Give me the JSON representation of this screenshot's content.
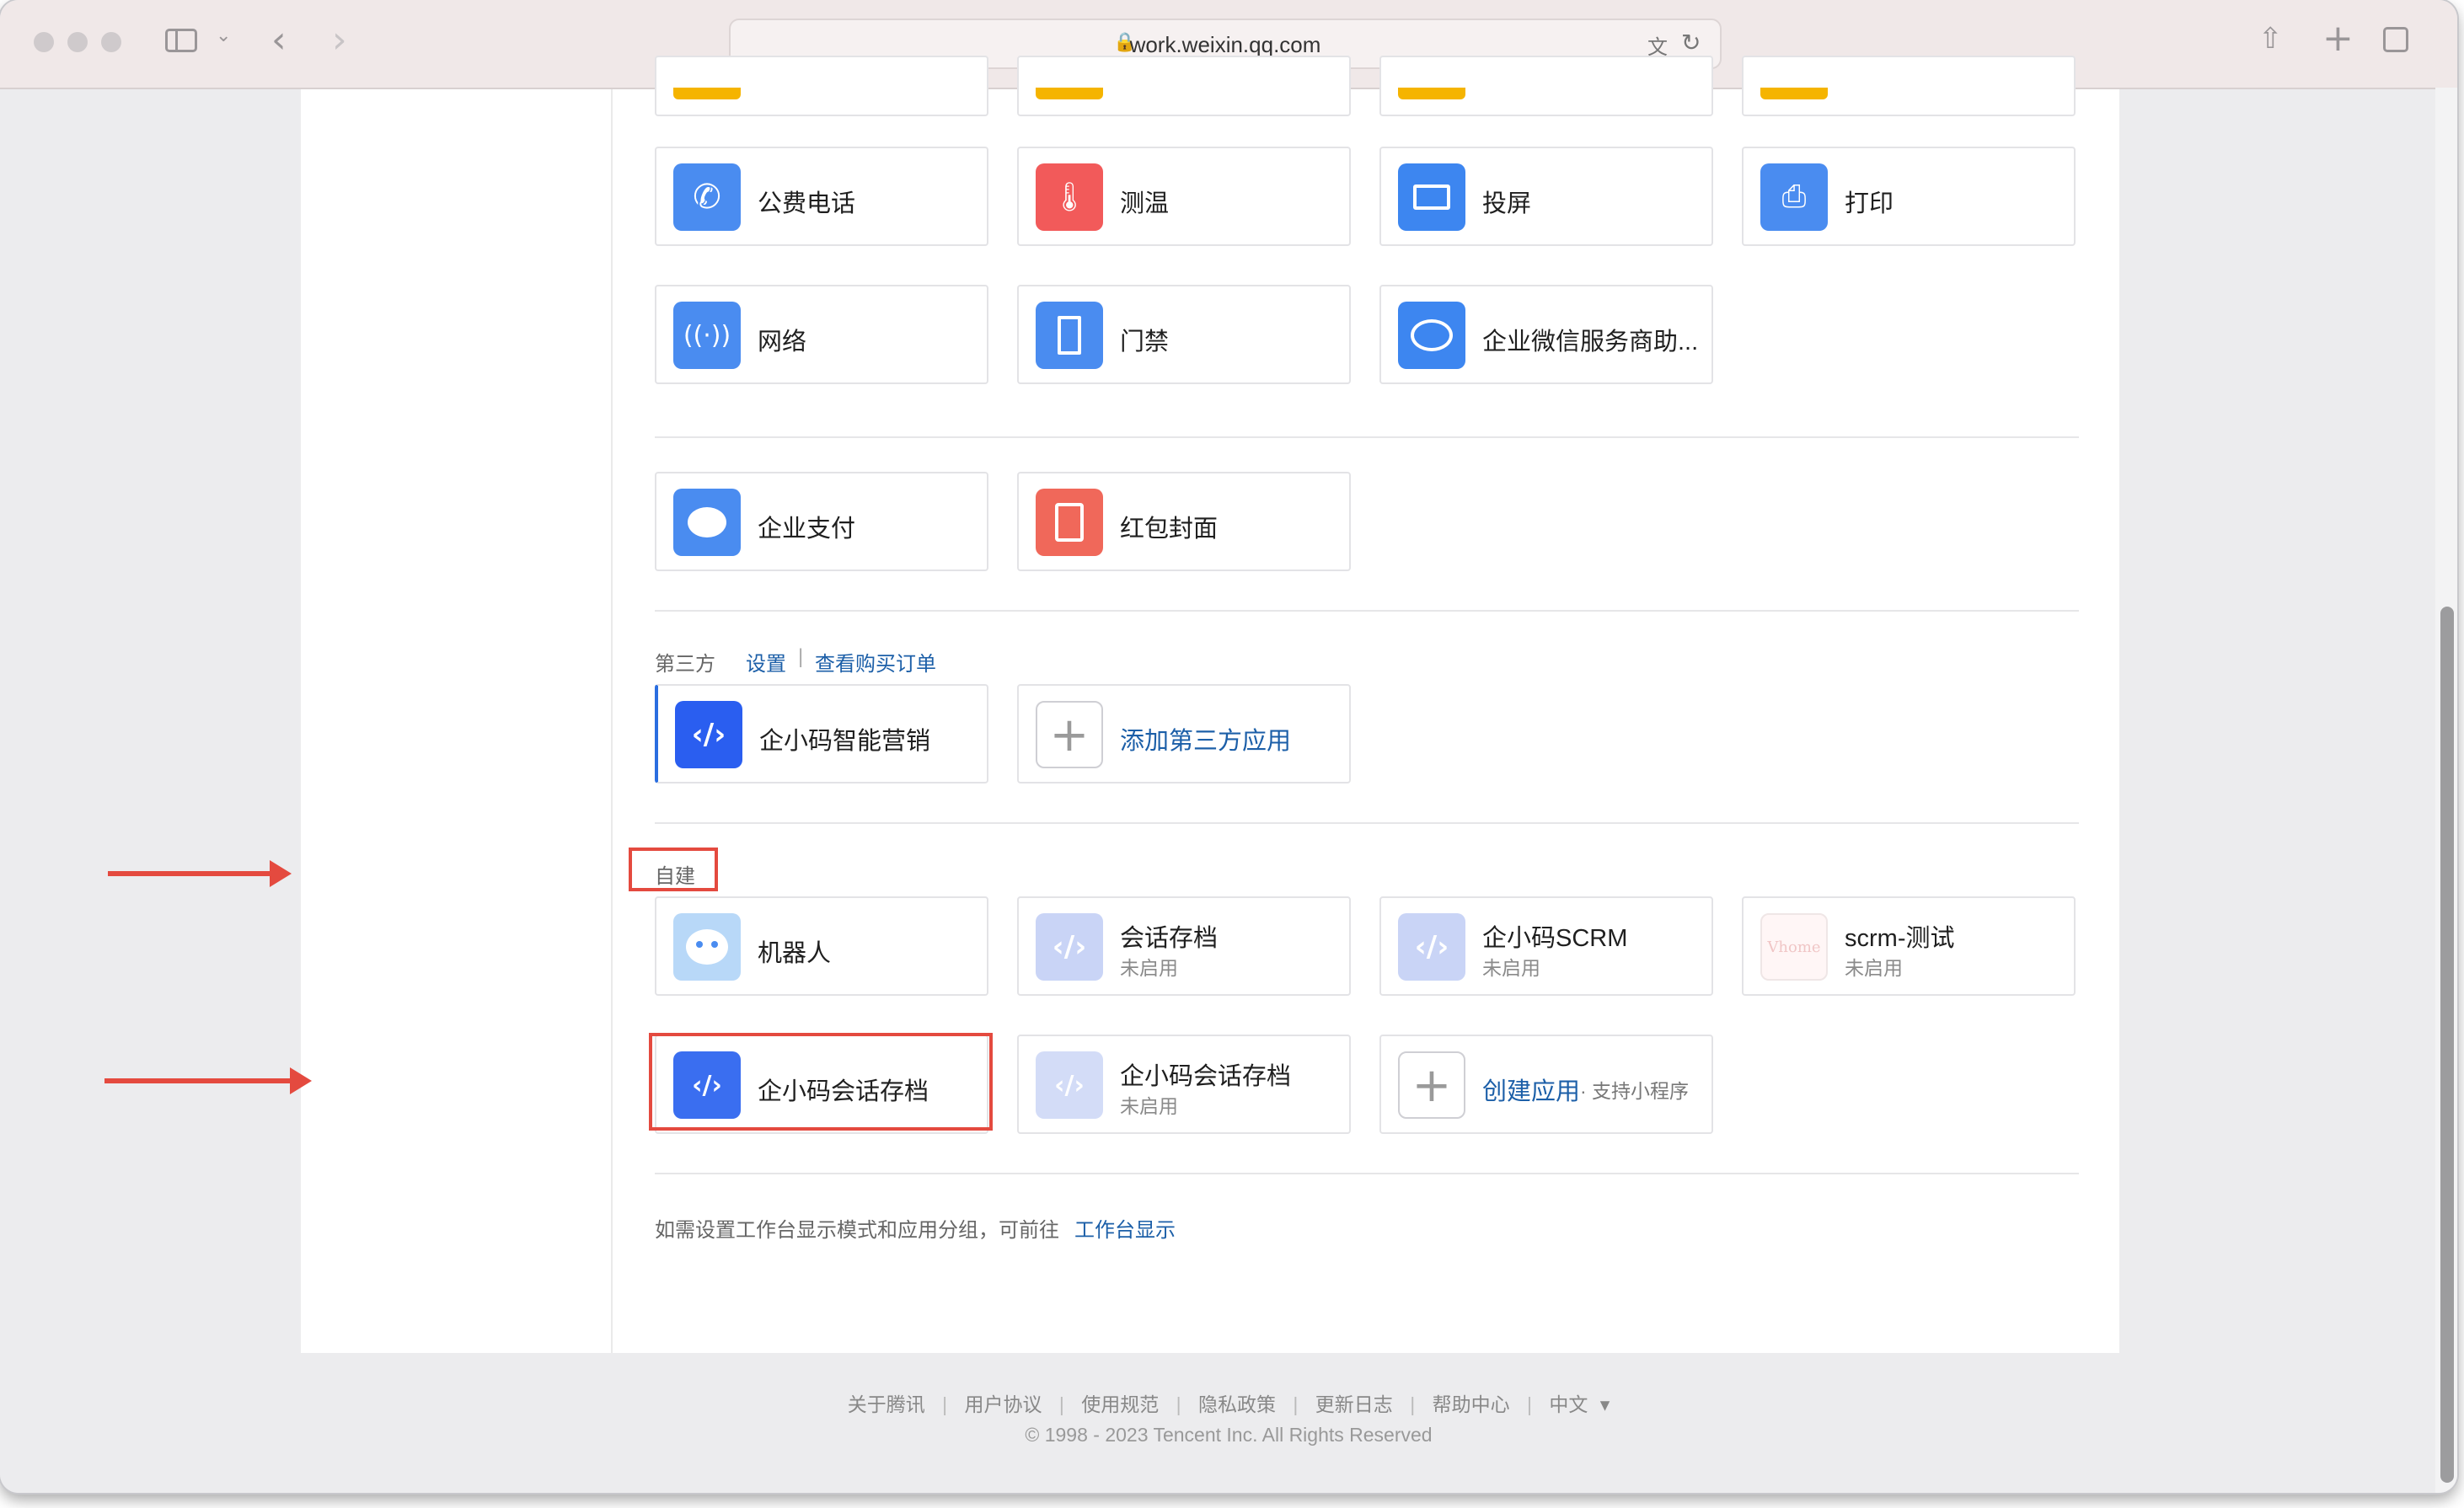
{
  "browser": {
    "url": "work.weixin.qq.com"
  },
  "apps_row1": [
    {
      "name": "公费电话",
      "icon": "phone-icon",
      "color": "#4a8cf0"
    },
    {
      "name": "测温",
      "icon": "thermometer-icon",
      "color": "#f25a5a"
    },
    {
      "name": "投屏",
      "icon": "screen-cast-icon",
      "color": "#3d86f0"
    },
    {
      "name": "打印",
      "icon": "printer-icon",
      "color": "#4a8cf0"
    }
  ],
  "apps_row2": [
    {
      "name": "网络",
      "icon": "router-icon",
      "color": "#4a8cf0"
    },
    {
      "name": "门禁",
      "icon": "door-icon",
      "color": "#4a8cf0"
    },
    {
      "name": "企业微信服务商助...",
      "icon": "chat-bubble-icon",
      "color": "#3d86f0"
    }
  ],
  "apps_pay": [
    {
      "name": "企业支付",
      "icon": "pay-icon",
      "color": "#4a8cf0"
    },
    {
      "name": "红包封面",
      "icon": "red-envelope-icon",
      "color": "#f0685a"
    }
  ],
  "third_party": {
    "label": "第三方",
    "settings": "设置",
    "separator": "|",
    "orders": "查看购买订单",
    "apps": [
      {
        "name": "企小码智能营销",
        "icon": "code-icon",
        "color": "#2a5ef0"
      }
    ],
    "add": "添加第三方应用"
  },
  "self_built": {
    "label": "自建",
    "apps": [
      {
        "name": "机器人",
        "sub": "",
        "icon": "robot-icon",
        "color": "#b8d8f8"
      },
      {
        "name": "会话存档",
        "sub": "未启用",
        "icon": "code-icon",
        "color": "#c9d4f6"
      },
      {
        "name": "企小码SCRM",
        "sub": "未启用",
        "icon": "code-icon",
        "color": "#c9d4f6"
      },
      {
        "name": "scrm-测试",
        "sub": "未启用",
        "icon": "vhome-logo-icon",
        "color": "#fff6f6",
        "logo_text": "Vhome"
      },
      {
        "name": "企小码会话存档",
        "sub": "",
        "icon": "code-icon",
        "color": "#3a6ef0"
      },
      {
        "name": "企小码会话存档",
        "sub": "未启用",
        "icon": "code-icon",
        "color": "#d3dcf7"
      }
    ],
    "create": "创建应用",
    "create_note": "· 支持小程序"
  },
  "hint": {
    "text": "如需设置工作台显示模式和应用分组，可前往",
    "link": "工作台显示"
  },
  "footer": {
    "links": [
      "关于腾讯",
      "用户协议",
      "使用规范",
      "隐私政策",
      "更新日志",
      "帮助中心",
      "中文"
    ],
    "lang_caret": "▾",
    "copyright": "© 1998 - 2023 Tencent Inc. All Rights Reserved"
  },
  "colors": {
    "accent": "#1c5fa8",
    "annotation": "#e44a3f"
  }
}
